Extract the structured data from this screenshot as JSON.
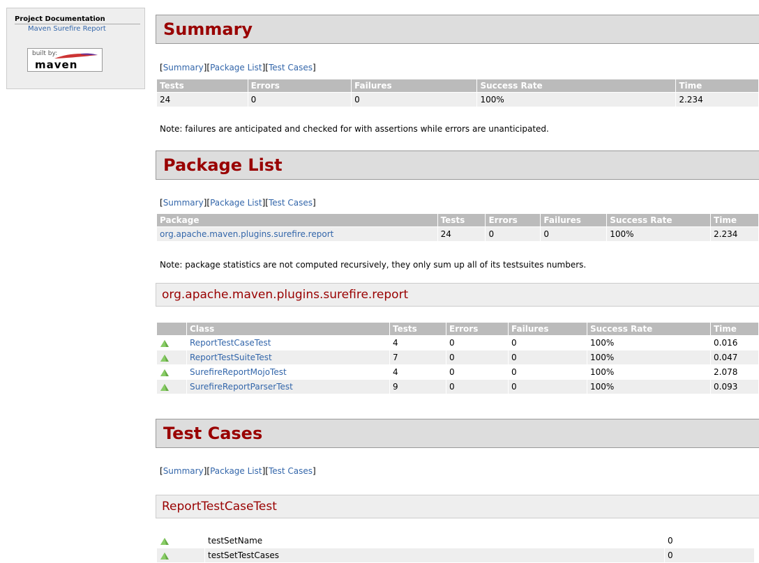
{
  "sidebar": {
    "section_title": "Project Documentation",
    "item": "Maven Surefire Report",
    "badge_built_by": "built by:",
    "badge_brand": "maven"
  },
  "nav": {
    "summary": "Summary",
    "package_list": "Package List",
    "test_cases": "Test Cases"
  },
  "summary": {
    "heading": "Summary",
    "headers": [
      "Tests",
      "Errors",
      "Failures",
      "Success Rate",
      "Time"
    ],
    "row": [
      "24",
      "0",
      "0",
      "100%",
      "2.234"
    ],
    "note": "Note: failures are anticipated and checked for with assertions while errors are unanticipated."
  },
  "package_list": {
    "heading": "Package List",
    "headers": [
      "Package",
      "Tests",
      "Errors",
      "Failures",
      "Success Rate",
      "Time"
    ],
    "row": [
      "org.apache.maven.plugins.surefire.report",
      "24",
      "0",
      "0",
      "100%",
      "2.234"
    ],
    "note": "Note: package statistics are not computed recursively, they only sum up all of its testsuites numbers."
  },
  "package": {
    "heading": "org.apache.maven.plugins.surefire.report",
    "headers": [
      "",
      "Class",
      "Tests",
      "Errors",
      "Failures",
      "Success Rate",
      "Time"
    ],
    "rows": [
      [
        "ReportTestCaseTest",
        "4",
        "0",
        "0",
        "100%",
        "0.016"
      ],
      [
        "ReportTestSuiteTest",
        "7",
        "0",
        "0",
        "100%",
        "0.047"
      ],
      [
        "SurefireReportMojoTest",
        "4",
        "0",
        "0",
        "100%",
        "2.078"
      ],
      [
        "SurefireReportParserTest",
        "9",
        "0",
        "0",
        "100%",
        "0.093"
      ]
    ]
  },
  "test_cases": {
    "heading": "Test Cases",
    "class_heading": "ReportTestCaseTest",
    "rows": [
      [
        "testSetName",
        "0"
      ],
      [
        "testSetTestCases",
        "0"
      ]
    ]
  },
  "icons": {
    "success": "success-icon"
  },
  "colors": {
    "heading_red": "#990000",
    "link": "#3366aa",
    "header_bg": "#bbbbbb"
  }
}
